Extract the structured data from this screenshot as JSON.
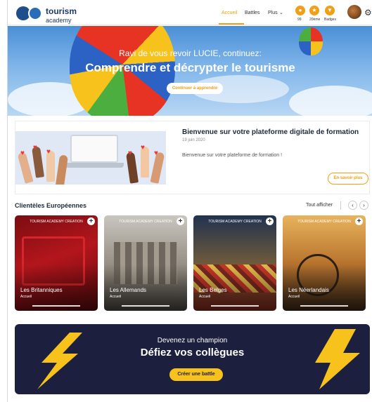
{
  "header": {
    "brand_line1": "tourism",
    "brand_line2": "academy",
    "nav": {
      "home": "Accueil",
      "battles": "Battles",
      "more": "Plus"
    },
    "stats": [
      {
        "value": "99",
        "label": "99",
        "icon": "points-icon"
      },
      {
        "value": "20",
        "label": "20ème",
        "icon": "rank-icon"
      },
      {
        "value": "B",
        "label": "Badges",
        "icon": "badge-icon"
      }
    ],
    "accent_color": "#f2a011"
  },
  "hero": {
    "subtitle": "Ravi de vous revoir LUCIE, continuez:",
    "title": "Comprendre et décrypter le tourisme",
    "cta": "Continuer à apprendre"
  },
  "welcome": {
    "title": "Bienvenue sur votre plateforme digitale de formation",
    "date": "19 juin 2020",
    "text": "Bienvenue sur votre plateforme de formation !",
    "cta": "En savoir plus"
  },
  "section": {
    "title": "Clientèles Européennes",
    "see_all": "Tout afficher",
    "tiles": [
      {
        "tag": "TOURISM ACADEMY CREATION",
        "name": "Les Britanniques",
        "sub": "Accueil"
      },
      {
        "tag": "TOURISM ACADEMY CREATION",
        "name": "Les Allemands",
        "sub": "Accueil"
      },
      {
        "tag": "TOURISM ACADEMY CREATION",
        "name": "Les Belges",
        "sub": "Accueil"
      },
      {
        "tag": "TOURISM ACADEMY CREATION",
        "name": "Les Néerlandais",
        "sub": "Accueil"
      }
    ]
  },
  "battle": {
    "subtitle": "Devenez un champion",
    "title": "Défiez vos collègues",
    "cta": "Créer une battle"
  }
}
